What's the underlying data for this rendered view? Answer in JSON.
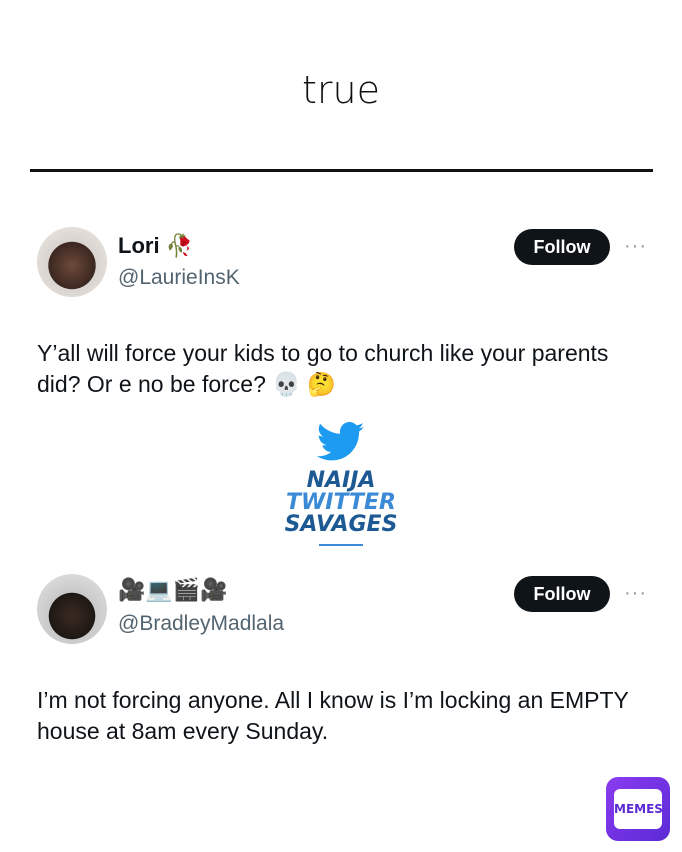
{
  "caption": "true",
  "tweets": [
    {
      "name": "Lori",
      "name_emoji": "🥀",
      "handle": "@LaurieInsK",
      "follow_label": "Follow",
      "more_label": "···",
      "text": "Y’all will force your kids to go to church like your parents did? Or e no be force? 💀 🤔"
    },
    {
      "name": "🎥💻🎬🎥",
      "handle": "@BradleyMadlala",
      "follow_label": "Follow",
      "more_label": "···",
      "text": "I’m not forcing anyone. All I know is I’m locking an EMPTY house at 8am every Sunday."
    }
  ],
  "watermark": {
    "icon": "twitter-bird-icon",
    "lines": [
      "NAIJA",
      "TWITTER",
      "SAVAGES"
    ]
  },
  "badge": {
    "text": "MEMES",
    "icon": "memes-mail-icon"
  },
  "colors": {
    "follow_bg": "#0f1419",
    "handle": "#536471",
    "watermark_dark": "#1d5a94",
    "watermark_light": "#3a8ad6",
    "badge": "#6a30e0"
  }
}
